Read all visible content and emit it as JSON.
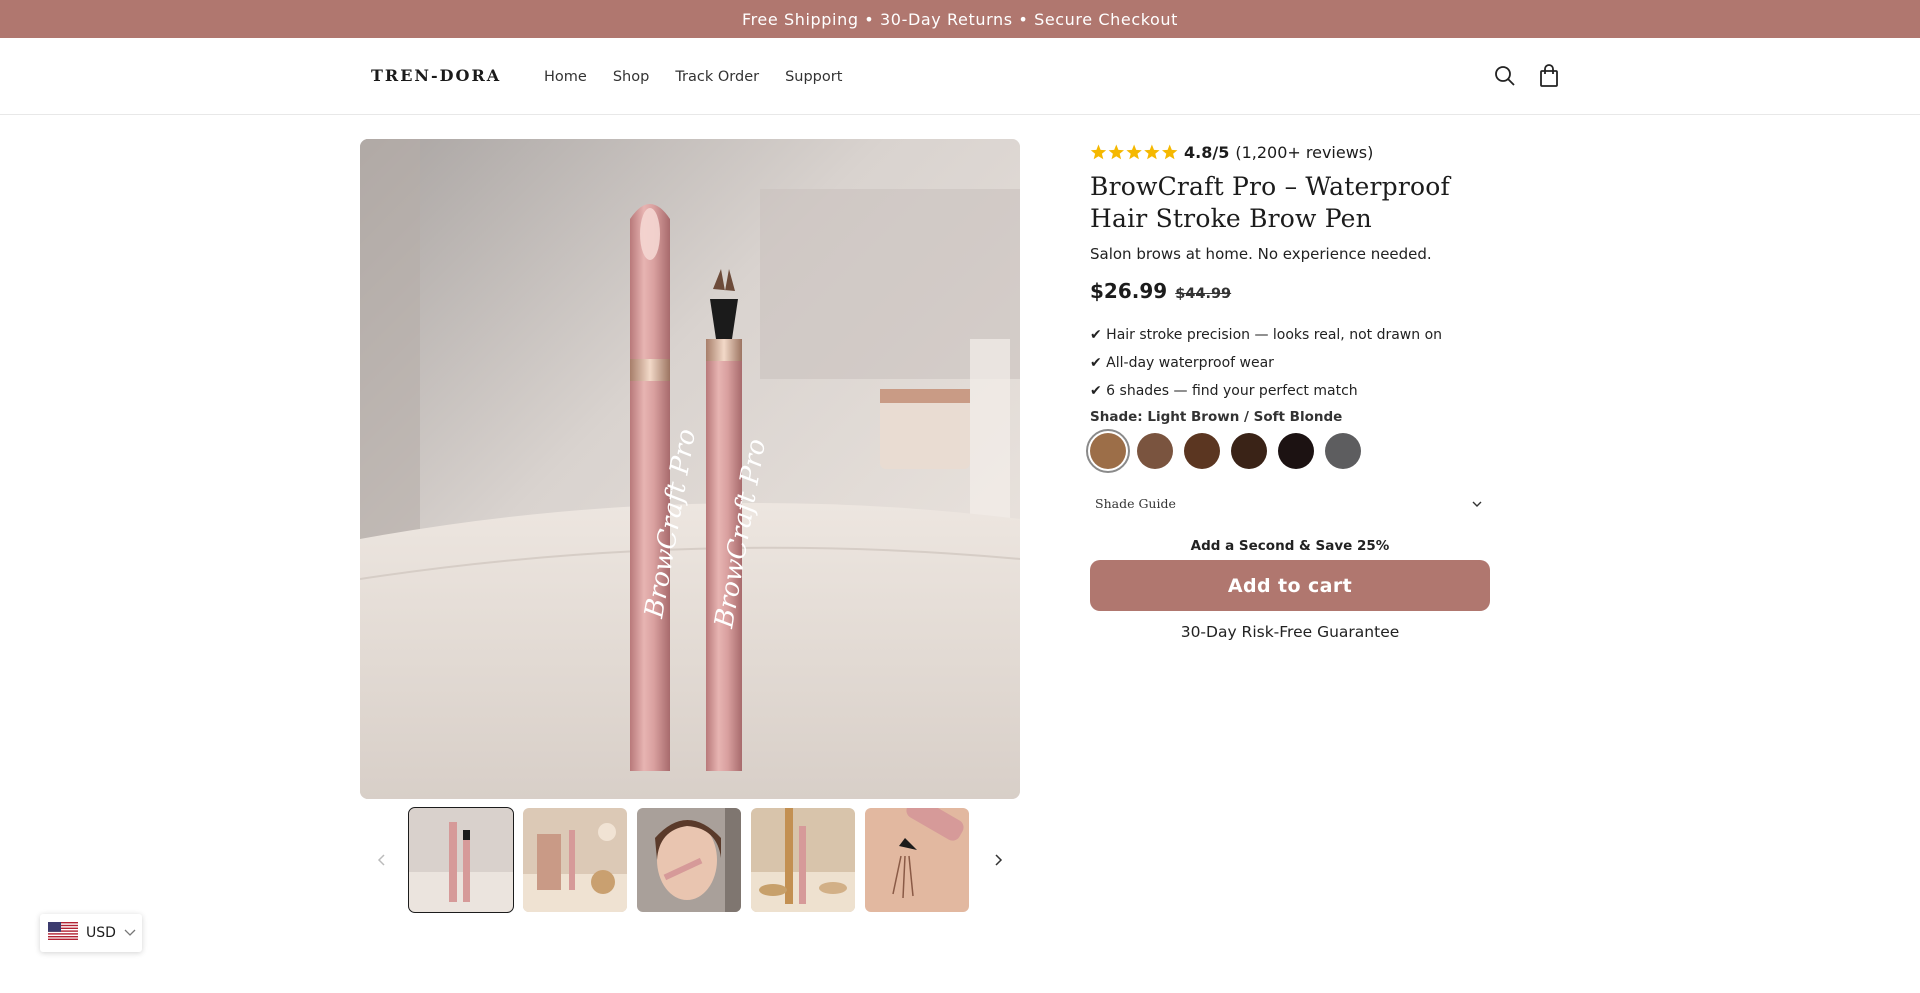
{
  "announcement": {
    "text": "Free Shipping • 30-Day Returns • Secure Checkout"
  },
  "header": {
    "logo": "TREN-DORA",
    "nav": [
      {
        "label": "Home"
      },
      {
        "label": "Shop"
      },
      {
        "label": "Track Order"
      },
      {
        "label": "Support"
      }
    ]
  },
  "product": {
    "rating_score": "4.8/5",
    "rating_count": "(1,200+ reviews)",
    "title": "BrowCraft Pro – Waterproof Hair Stroke Brow Pen",
    "subtitle": "Salon brows at home. No experience needed.",
    "price": "$26.99",
    "compare_price": "$44.99",
    "features": [
      "✔ Hair stroke precision — looks real, not drawn on",
      "✔ All-day waterproof wear",
      "✔ 6 shades — find your perfect match"
    ],
    "shade_label": "Shade: Light Brown / Soft Blonde",
    "swatches": [
      "#9c6e48",
      "#7a543f",
      "#5b3621",
      "#3a2317",
      "#1c1212",
      "#5d5d5f"
    ],
    "shade_guide_label": "Shade Guide",
    "bundle_text": "Add a Second & Save 25%",
    "add_to_cart": "Add to cart",
    "guarantee": "30-Day Risk-Free Guarantee",
    "pen_text": "BrowCraft Pro"
  },
  "currency": {
    "code": "USD"
  },
  "colors": {
    "accent": "#b0776f",
    "star": "#f5b800"
  }
}
